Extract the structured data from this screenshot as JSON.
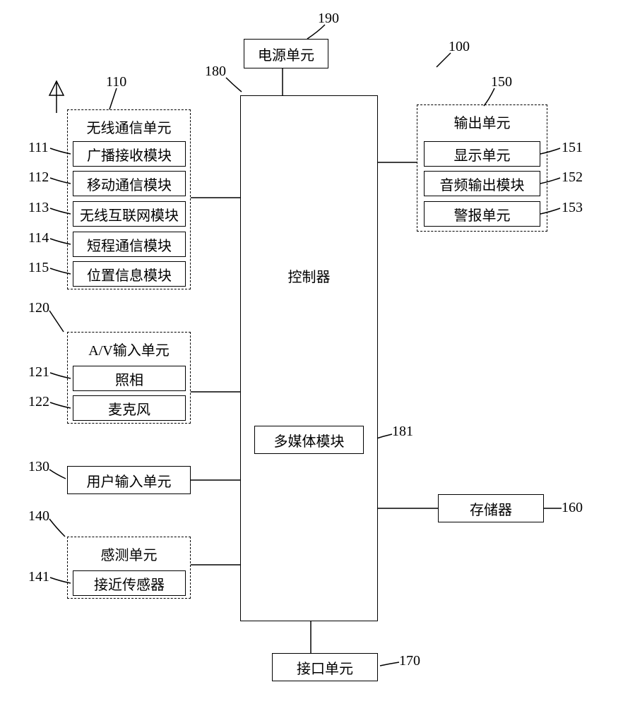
{
  "labels": {
    "l100": "100",
    "l110": "110",
    "l111": "111",
    "l112": "112",
    "l113": "113",
    "l114": "114",
    "l115": "115",
    "l120": "120",
    "l121": "121",
    "l122": "122",
    "l130": "130",
    "l140": "140",
    "l141": "141",
    "l150": "150",
    "l151": "151",
    "l152": "152",
    "l153": "153",
    "l160": "160",
    "l170": "170",
    "l180": "180",
    "l181": "181",
    "l190": "190"
  },
  "boxes": {
    "power": "电源单元",
    "wireless_title": "无线通信单元",
    "broadcast": "广播接收模块",
    "mobile_comm": "移动通信模块",
    "wireless_net": "无线互联网模块",
    "short_range": "短程通信模块",
    "position": "位置信息模块",
    "av_title": "A/V输入单元",
    "camera": "照相",
    "mic": "麦克风",
    "user_input": "用户输入单元",
    "sensing_title": "感测单元",
    "proximity": "接近传感器",
    "controller": "控制器",
    "multimedia": "多媒体模块",
    "output_title": "输出单元",
    "display": "显示单元",
    "audio_out": "音频输出模块",
    "alarm": "警报单元",
    "memory": "存储器",
    "interface": "接口单元"
  }
}
